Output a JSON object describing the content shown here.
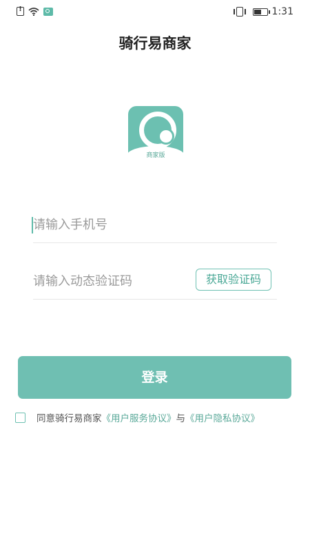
{
  "status_bar": {
    "time": "1:31",
    "battery_level": 0.5,
    "icons": [
      "alert-icon",
      "wifi-icon",
      "app-notification-icon",
      "vibrate-icon",
      "battery-icon"
    ]
  },
  "header": {
    "title": "骑行易商家"
  },
  "logo": {
    "label": "商家版",
    "color": "#6cc0b1"
  },
  "form": {
    "phone_placeholder": "请输入手机号",
    "code_placeholder": "请输入动态验证码",
    "get_code_label": "获取验证码"
  },
  "login": {
    "label": "登录",
    "color": "#6fbfb2"
  },
  "agreement": {
    "prefix": "同意骑行易商家",
    "user_service_link": "《用户服务协议》",
    "connector": "与",
    "privacy_link": "《用户隐私协议》",
    "checked": false
  },
  "colors": {
    "accent": "#6cc0b1",
    "link": "#5aa999"
  }
}
